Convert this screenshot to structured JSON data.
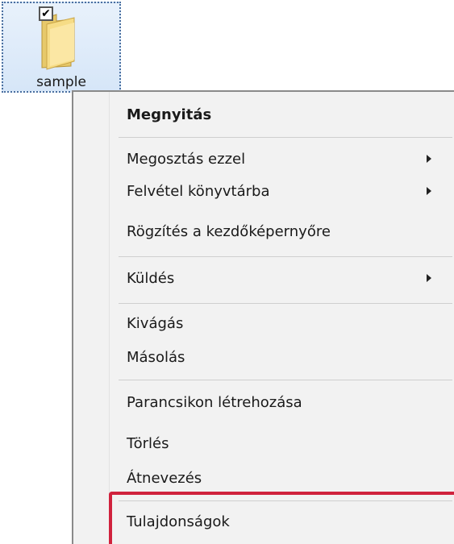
{
  "desktop": {
    "folder": {
      "name": "sample",
      "checked": true,
      "checkmark": "✔"
    }
  },
  "context_menu": {
    "open": "Megnyitás",
    "share_with": "Megosztás ezzel",
    "include_in_library": "Felvétel könyvtárba",
    "pin_to_start": "Rögzítés a kezdőképernyőre",
    "send_to": "Küldés",
    "cut": "Kivágás",
    "copy": "Másolás",
    "create_shortcut": "Parancsikon létrehozása",
    "delete": "Törlés",
    "rename": "Átnevezés",
    "properties": "Tulajdonságok"
  },
  "colors": {
    "highlight": "#d0223d",
    "menu_bg": "#f2f2f2"
  }
}
